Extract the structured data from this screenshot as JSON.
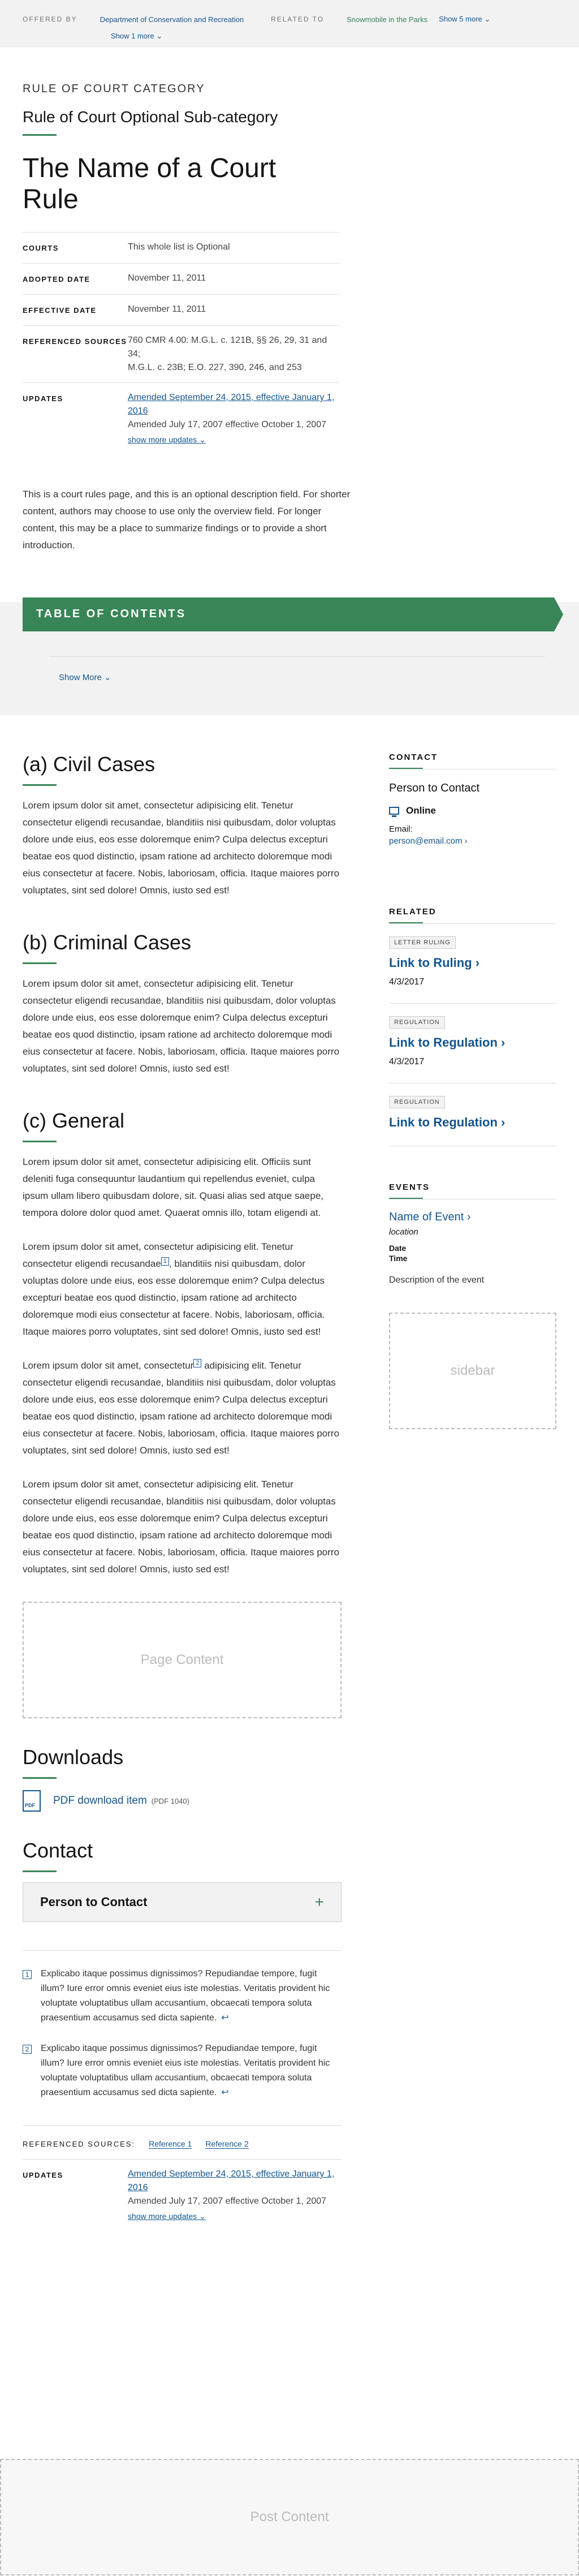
{
  "top": {
    "offered_by_label": "OFFERED BY",
    "offered_by_link": "Department of Conservation and Recreation",
    "show_more_1": "Show 1 more ⌄",
    "related_label": "RELATED TO",
    "related_link": "Snowmobile in the Parks",
    "show_more_5": "Show 5 more ⌄"
  },
  "header": {
    "category": "RULE OF COURT CATEGORY",
    "subcategory": "Rule of Court Optional Sub-category",
    "title": "The Name of a Court Rule"
  },
  "meta": [
    {
      "key": "COURTS",
      "value": "This whole list is Optional"
    },
    {
      "key": "ADOPTED DATE",
      "value": "November 11, 2011"
    },
    {
      "key": "EFFECTIVE DATE",
      "value": "November 11, 2011"
    },
    {
      "key": "REFERENCED SOURCES",
      "value": "760 CMR 4.00: M.G.L. c. 121B, §§ 26, 29, 31 and 34;",
      "value2": "M.G.L. c. 23B; E.O. 227, 390, 246, and 253"
    },
    {
      "key": "UPDATES",
      "link": "Amended September 24, 2015, effective January 1, 2016",
      "value": "Amended July 17, 2007 effective October 1, 2007",
      "more": "show more updates ⌄"
    }
  ],
  "intro": "This is a court rules page, and this is an optional description field. For shorter content, authors may choose to use only the overview field. For longer content, this may be a place to summarize findings or to provide a short introduction.",
  "toc": {
    "title": "TABLE OF CONTENTS",
    "show_more": "Show More ⌄"
  },
  "sections": {
    "civil": {
      "heading": "(a) Civil Cases",
      "text": "Lorem ipsum dolor sit amet, consectetur adipisicing elit. Tenetur consectetur eligendi recusandae, blanditiis nisi quibusdam, dolor voluptas dolore unde eius, eos esse doloremque enim? Culpa delectus excepturi beatae eos quod distinctio, ipsam ratione ad architecto doloremque modi eius consectetur at facere. Nobis, laboriosam, officia. Itaque maiores porro voluptates, sint sed dolore! Omnis, iusto sed est!"
    },
    "criminal": {
      "heading": "(b) Criminal Cases",
      "text": "Lorem ipsum dolor sit amet, consectetur adipisicing elit. Tenetur consectetur eligendi recusandae, blanditiis nisi quibusdam, dolor voluptas dolore unde eius, eos esse doloremque enim? Culpa delectus excepturi beatae eos quod distinctio, ipsam ratione ad architecto doloremque modi eius consectetur at facere. Nobis, laboriosam, officia. Itaque maiores porro voluptates, sint sed dolore! Omnis, iusto sed est!"
    },
    "general": {
      "heading": "(c) General",
      "p1": "Lorem ipsum dolor sit amet, consectetur adipisicing elit. Officiis sunt deleniti fuga consequuntur laudantium qui repellendus eveniet, culpa ipsum ullam libero quibusdam dolore, sit. Quasi alias sed atque saepe, tempora dolore dolor quod amet. Quaerat omnis illo, totam eligendi at.",
      "p2a": "Lorem ipsum dolor sit amet, consectetur adipisicing elit. Tenetur consectetur eligendi recusandae",
      "p2b": ", blanditiis nisi quibusdam, dolor voluptas dolore unde eius, eos esse doloremque enim? Culpa delectus excepturi beatae eos quod distinctio, ipsam ratione ad architecto doloremque modi eius consectetur at facere. Nobis, laboriosam, officia. Itaque maiores porro voluptates, sint sed dolore! Omnis, iusto sed est!",
      "p3a": "Lorem ipsum dolor sit amet, consectetur",
      "p3b": " adipisicing elit. Tenetur consectetur eligendi recusandae, blanditiis nisi quibusdam, dolor voluptas dolore unde eius, eos esse doloremque enim? Culpa delectus excepturi beatae eos quod distinctio, ipsam ratione ad architecto doloremque modi eius consectetur at facere. Nobis, laboriosam, officia. Itaque maiores porro voluptates, sint sed dolore! Omnis, iusto sed est!",
      "p4": "Lorem ipsum dolor sit amet, consectetur adipisicing elit. Tenetur consectetur eligendi recusandae, blanditiis nisi quibusdam, dolor voluptas dolore unde eius, eos esse doloremque enim? Culpa delectus excepturi beatae eos quod distinctio, ipsam ratione ad architecto doloremque modi eius consectetur at facere. Nobis, laboriosam, officia. Itaque maiores porro voluptates, sint sed dolore! Omnis, iusto sed est!",
      "fn1": "1",
      "fn2": "2"
    }
  },
  "page_content_placeholder": "Page Content",
  "downloads": {
    "heading": "Downloads",
    "item": "PDF download item",
    "item_meta": "(PDF 1040)"
  },
  "contact": {
    "heading": "Contact",
    "person": "Person to Contact",
    "plus": "+"
  },
  "footnotes": [
    {
      "num": "1",
      "text": "Explicabo itaque possimus dignissimos? Repudiandae tempore, fugit illum? Iure error omnis eveniet eius iste molestias. Veritatis provident hic voluptate voluptatibus ullam accusantium, obcaecati tempora soluta praesentium accusamus sed dicta sapiente.",
      "return": "↩"
    },
    {
      "num": "2",
      "text": "Explicabo itaque possimus dignissimos? Repudiandae tempore, fugit illum? Iure error omnis eveniet eius iste molestias. Veritatis provident hic voluptate voluptatibus ullam accusantium, obcaecati tempora soluta praesentium accusamus sed dicta sapiente.",
      "return": "↩"
    }
  ],
  "bottom_refs": {
    "label": "REFERENCED SOURCES:",
    "ref1": "Reference 1",
    "ref2": "Reference 2"
  },
  "bottom_updates": {
    "key": "UPDATES",
    "link": "Amended September 24, 2015, effective January 1, 2016",
    "value": "Amended July 17, 2007 effective October 1, 2007",
    "more": "show more updates ⌄"
  },
  "post_content_placeholder": "Post Content",
  "sidebar": {
    "contact_h": "CONTACT",
    "person": "Person to Contact",
    "online": "Online",
    "email_label": "Email:",
    "email": "person@email.com ›",
    "related_h": "RELATED",
    "related": [
      {
        "tag": "LETTER RULING",
        "link": "Link to Ruling ›",
        "date": "4/3/2017"
      },
      {
        "tag": "REGULATION",
        "link": "Link to Regulation ›",
        "date": "4/3/2017"
      },
      {
        "tag": "REGULATION",
        "link": "Link to Regulation ›",
        "date": ""
      }
    ],
    "events_h": "EVENTS",
    "event_name": "Name of Event ›",
    "event_location": "location",
    "event_date": "Date",
    "event_time": "Time",
    "event_desc": "Description of the event",
    "placeholder": "sidebar"
  }
}
